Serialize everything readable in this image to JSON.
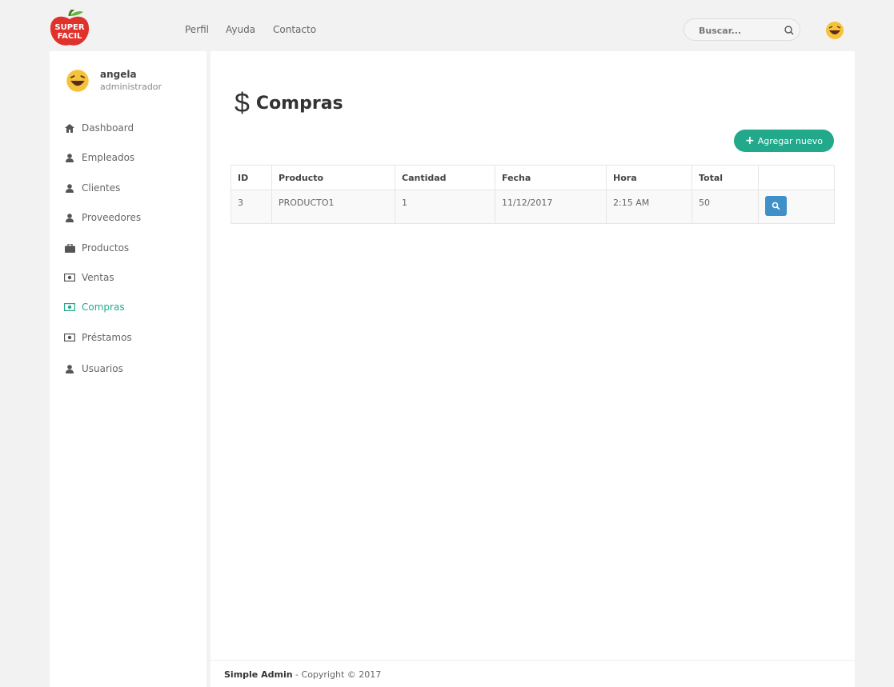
{
  "logo": {
    "text_line1": "SUPER",
    "text_line2": "FACIL"
  },
  "topnav": {
    "items": [
      "Perfil",
      "Ayuda",
      "Contacto"
    ]
  },
  "search": {
    "placeholder": "Buscar..."
  },
  "user": {
    "name": "angela",
    "role": "administrador"
  },
  "sidebar": {
    "items": [
      {
        "label": "Dashboard",
        "icon": "home-icon"
      },
      {
        "label": "Empleados",
        "icon": "user-icon"
      },
      {
        "label": "Clientes",
        "icon": "user-icon"
      },
      {
        "label": "Proveedores",
        "icon": "user-icon"
      },
      {
        "label": "Productos",
        "icon": "briefcase-icon"
      },
      {
        "label": "Ventas",
        "icon": "money-icon"
      },
      {
        "label": "Compras",
        "icon": "money-icon",
        "active": true
      },
      {
        "label": "Préstamos",
        "icon": "money-icon"
      },
      {
        "label": "Usuarios",
        "icon": "user-icon"
      }
    ]
  },
  "page": {
    "title_symbol": "$",
    "title": "Compras",
    "add_button": "Agregar nuevo"
  },
  "table": {
    "columns": [
      "ID",
      "Producto",
      "Cantidad",
      "Fecha",
      "Hora",
      "Total",
      ""
    ],
    "rows": [
      [
        "3",
        "PRODUCTO1",
        "1",
        "11/12/2017",
        "2:15 AM",
        "50"
      ]
    ]
  },
  "footer": {
    "brand": "Simple Admin",
    "text": " - Copyright © 2017"
  },
  "colors": {
    "accent": "#22a88a",
    "view_button": "#3f8fc9",
    "logo_red": "#e0312b"
  }
}
